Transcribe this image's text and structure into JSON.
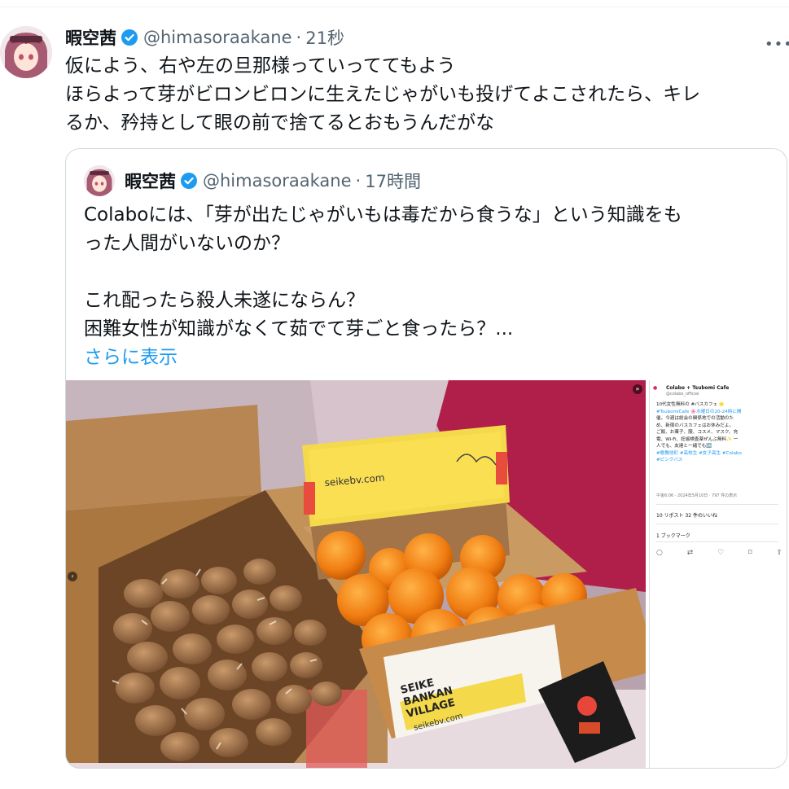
{
  "tweet": {
    "display_name": "暇空茜",
    "handle": "@himasoraakane",
    "separator": "·",
    "time": "21秒",
    "lines": [
      "仮によう、右や左の旦那様っていっててもよう",
      "ほらよって芽がビロンビロンに生えたじゃがいも投げてよこされたら、キレ",
      "るか、矜持として眼の前で捨てるとおもうんだがな"
    ]
  },
  "quote": {
    "display_name": "暇空茜",
    "handle": "@himasoraakane",
    "separator": "·",
    "time": "17時間",
    "lines": [
      "Colaboには、「芽が出たじゃがいもは毒だから食うな」という知識をも",
      "った人間がいないのか？",
      "",
      "これ配ったら殺人未遂にならん？",
      "困難女性が知識がなくて茹でて芽ごと食ったら？..."
    ],
    "show_more": "さらに表示"
  },
  "photo": {
    "box_label": "seikebv.com",
    "box_side_lines": [
      "SEIKE",
      "BANKAN",
      "VILLAGE",
      "seikebv.com"
    ]
  },
  "embedded_post": {
    "name": "Colabo + Tsubomi Cafe",
    "handle": "@colabo_official",
    "body_lines": [
      "10代女性無料の #バスカフェ 🌟",
      "#TsubomiCafe 🌸水曜日の20-24時に開",
      "催。今週は総会の関係地での活動のた",
      "め、新宿のバスカフェはお休みだよ。",
      "ご飯、お菓子、服、コスメ、マスク、充",
      "電、Wi-Fi、妊娠検査薬ぜんぶ無料✨ 一",
      "人でも、友達と一緒でも🆗",
      "#歌舞伎町 #高校生 #女子高生 #Colabo",
      "#ピンクバス"
    ],
    "meta": "午後6:06 · 2024年5月10日 · 797 件の表示",
    "stats": "10 リポスト   32 件のいいね",
    "bookmarks": "1 ブックマーク"
  },
  "colors": {
    "verified": "#1d9bf0",
    "link": "#1d9bf0",
    "muted": "#536471",
    "border": "#cfd9de"
  },
  "icons": [
    "verified-badge-icon",
    "more-options-icon",
    "reply-icon",
    "repost-icon",
    "like-icon",
    "bookmark-icon",
    "share-icon"
  ]
}
